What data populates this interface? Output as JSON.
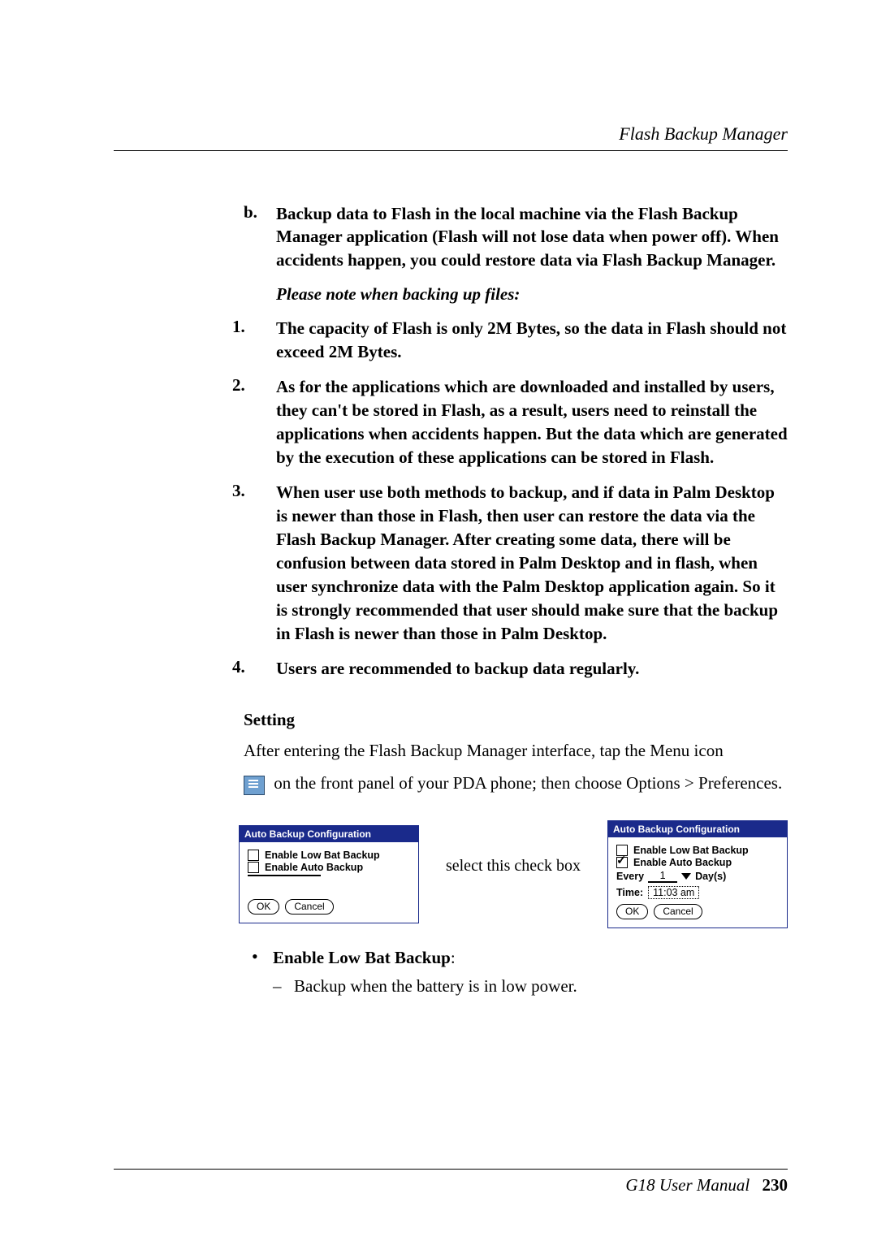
{
  "header": {
    "section_title": "Flash Backup Manager"
  },
  "step_b": {
    "marker": "b.",
    "text": "Backup data to Flash in the local machine via the Flash Backup Manager application (Flash will not lose data when power off). When accidents happen, you could restore data via Flash Backup Manager."
  },
  "note_heading": "Please note when backing up files:",
  "notes": {
    "n1": {
      "marker": "1.",
      "text": "The capacity of Flash is only 2M Bytes, so the data in Flash should not exceed 2M Bytes."
    },
    "n2": {
      "marker": "2.",
      "text": "As for the applications which are downloaded and installed by users, they can't be stored in Flash, as a result, users need to reinstall the applications when accidents happen. But the data which are generated by the execution of these applications can be stored in Flash."
    },
    "n3": {
      "marker": "3.",
      "text": "When user use both methods to backup, and if data in Palm Desktop is newer than those in Flash, then user can restore the data via the Flash Backup Manager. After creating some data, there will be confusion between data stored in Palm Desktop and  in flash, when user synchronize data with the Palm Desktop application again. So it is strongly recommended that user should make sure that the backup in Flash is newer than those in Palm Desktop."
    },
    "n4": {
      "marker": "4.",
      "text": "Users are recommended to backup data regularly."
    }
  },
  "setting": {
    "heading": "Setting",
    "para1": "After entering the Flash Backup Manager interface, tap the Menu icon",
    "para2": " on the front panel of your PDA phone; then choose Options > Preferences."
  },
  "pda_left": {
    "title": "Auto Backup Configuration",
    "opt1": "Enable Low Bat Backup",
    "opt2": "Enable Auto Backup",
    "ok": "OK",
    "cancel": "Cancel"
  },
  "mid_label": "select this check box",
  "pda_right": {
    "title": "Auto Backup Configuration",
    "opt1": "Enable Low Bat Backup",
    "opt2": "Enable Auto Backup",
    "every_label": "Every",
    "every_val": "1",
    "days": "Day(s)",
    "time_label": "Time:",
    "time_val": "11:03 am",
    "ok": "OK",
    "cancel": "Cancel"
  },
  "bullets": {
    "title": "Enable Low Bat Backup",
    "colon": ":",
    "sub": "Backup when the battery is in low power."
  },
  "footer": {
    "manual": "G18 User Manual",
    "page": "230"
  }
}
